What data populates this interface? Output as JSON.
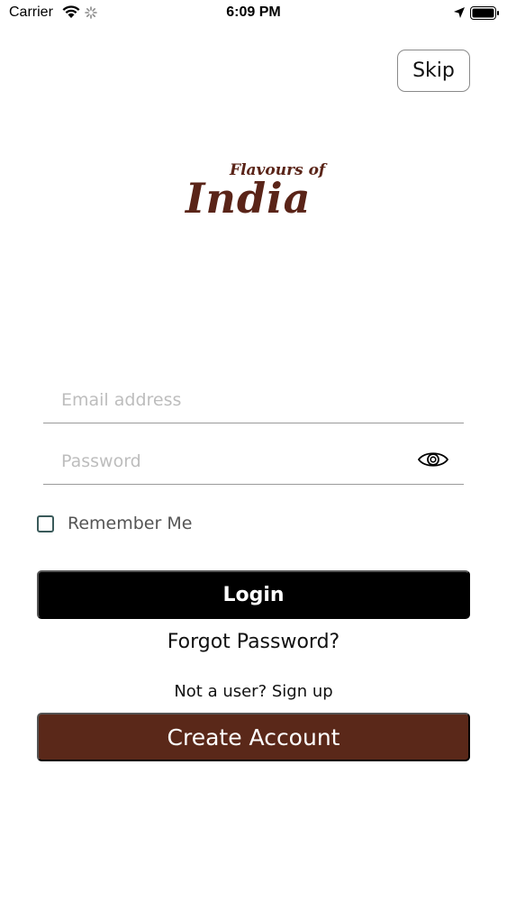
{
  "status_bar": {
    "carrier": "Carrier",
    "time": "6:09 PM"
  },
  "header": {
    "skip_label": "Skip"
  },
  "logo": {
    "top_text": "Flavours of",
    "main_text": "India",
    "color": "#5a2418"
  },
  "form": {
    "email_placeholder": "Email address",
    "email_value": "",
    "password_placeholder": "Password",
    "password_value": "",
    "remember_label": "Remember Me",
    "remember_checked": false
  },
  "actions": {
    "login_label": "Login",
    "forgot_label": "Forgot Password?",
    "signup_text": "Not a user? Sign up",
    "create_label": "Create Account"
  },
  "colors": {
    "login_bg": "#000000",
    "create_bg": "#5a2819"
  },
  "icons": [
    "wifi-icon",
    "activity-spinner-icon",
    "location-arrow-icon",
    "battery-icon",
    "eye-icon"
  ]
}
